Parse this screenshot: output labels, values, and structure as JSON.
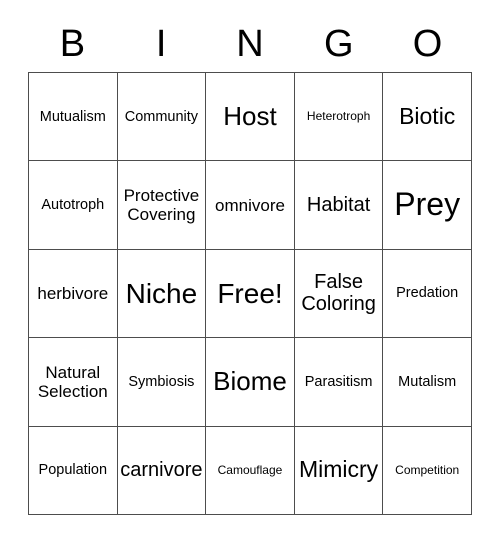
{
  "card": {
    "title": "BINGO",
    "header_letters": [
      "B",
      "I",
      "N",
      "G",
      "O"
    ],
    "free_space_label": "Free!",
    "colors": {
      "background": "#ffffff",
      "text": "#000000",
      "grid_line": "#4d4d4d"
    },
    "grid": {
      "columns": 5,
      "rows": 5,
      "cells": [
        {
          "text": "Mutualism",
          "size": "fs-sm"
        },
        {
          "text": "Community",
          "size": "fs-sm"
        },
        {
          "text": "Host",
          "size": "fs-2xl"
        },
        {
          "text": "Heterotroph",
          "size": "fs-xs"
        },
        {
          "text": "Biotic",
          "size": "fs-xl"
        },
        {
          "text": "Autotroph",
          "size": "fs-sm"
        },
        {
          "text": "Protective\nCovering",
          "size": "fs-md"
        },
        {
          "text": "omnivore",
          "size": "fs-md"
        },
        {
          "text": "Habitat",
          "size": "fs-lg"
        },
        {
          "text": "Prey",
          "size": "fs-4xl"
        },
        {
          "text": "herbivore",
          "size": "fs-md"
        },
        {
          "text": "Niche",
          "size": "fs-3xl"
        },
        {
          "text": "Free!",
          "size": "fs-3xl"
        },
        {
          "text": "False\nColoring",
          "size": "fs-lg"
        },
        {
          "text": "Predation",
          "size": "fs-sm"
        },
        {
          "text": "Natural\nSelection",
          "size": "fs-md"
        },
        {
          "text": "Symbiosis",
          "size": "fs-sm"
        },
        {
          "text": "Biome",
          "size": "fs-2xl"
        },
        {
          "text": "Parasitism",
          "size": "fs-sm"
        },
        {
          "text": "Mutalism",
          "size": "fs-sm"
        },
        {
          "text": "Population",
          "size": "fs-sm"
        },
        {
          "text": "carnivore",
          "size": "fs-lg"
        },
        {
          "text": "Camouflage",
          "size": "fs-xs"
        },
        {
          "text": "Mimicry",
          "size": "fs-xl"
        },
        {
          "text": "Competition",
          "size": "fs-xs"
        }
      ]
    }
  }
}
